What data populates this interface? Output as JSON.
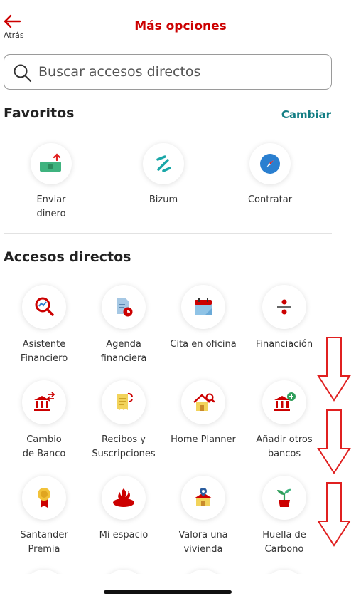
{
  "header": {
    "back_label": "Atrás",
    "title": "Más opciones"
  },
  "search": {
    "placeholder": "Buscar accesos directos"
  },
  "favorites": {
    "title": "Favoritos",
    "change_label": "Cambiar",
    "items": [
      {
        "line1": "Enviar",
        "line2": "dinero",
        "icon": "money-send-icon"
      },
      {
        "line1": "Bizum",
        "line2": "",
        "icon": "bizum-icon"
      },
      {
        "line1": "Contratar",
        "line2": "",
        "icon": "compass-icon"
      }
    ]
  },
  "shortcuts": {
    "title": "Accesos directos",
    "items": [
      {
        "line1": "Asistente",
        "line2": "Financiero",
        "icon": "magnifier-chart-icon"
      },
      {
        "line1": "Agenda",
        "line2": "financiera",
        "icon": "document-clock-icon"
      },
      {
        "line1": "Cita en oficina",
        "line2": "",
        "icon": "calendar-icon"
      },
      {
        "line1": "Financiación",
        "line2": "",
        "icon": "divide-icon"
      },
      {
        "line1": "Cambio",
        "line2": "de Banco",
        "icon": "bank-switch-icon"
      },
      {
        "line1": "Recibos y",
        "line2": "Suscripciones",
        "icon": "receipts-icon"
      },
      {
        "line1": "Home Planner",
        "line2": "",
        "icon": "house-search-icon"
      },
      {
        "line1": "Añadir otros",
        "line2": "bancos",
        "icon": "bank-add-icon"
      },
      {
        "line1": "Santander",
        "line2": "Premia",
        "icon": "medal-icon"
      },
      {
        "line1": "Mi espacio",
        "line2": "",
        "icon": "santander-flame-icon"
      },
      {
        "line1": "Valora una",
        "line2": "vivienda",
        "icon": "house-location-icon"
      },
      {
        "line1": "Huella de",
        "line2": "Carbono",
        "icon": "plant-icon"
      }
    ]
  },
  "colors": {
    "brand_red": "#cc0000",
    "link_teal": "#137e84",
    "annotation_arrow": "#e02020"
  }
}
